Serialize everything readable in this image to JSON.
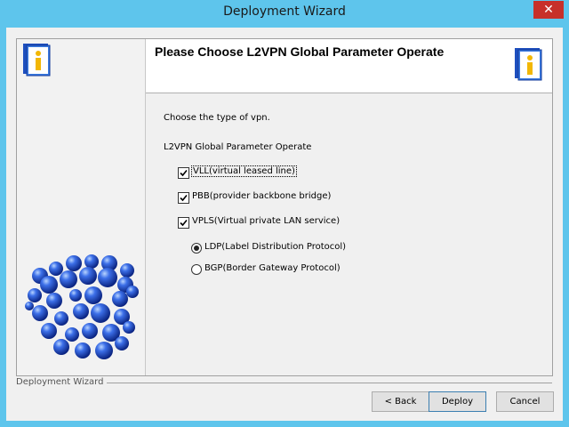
{
  "window": {
    "title": "Deployment Wizard",
    "close_glyph": "✕"
  },
  "header": {
    "title": "Please Choose L2VPN Global Parameter Operate",
    "icon": "info-icon"
  },
  "body": {
    "intro": "Choose the type of vpn.",
    "group_label": "L2VPN Global Parameter Operate",
    "options": [
      {
        "label": "VLL(virtual leased line)",
        "checked": true,
        "focused": true
      },
      {
        "label": "PBB(provider backbone bridge)",
        "checked": true
      },
      {
        "label": "VPLS(Virtual private LAN service)",
        "checked": true
      }
    ],
    "radios": [
      {
        "label": "LDP(Label Distribution Protocol)",
        "selected": true
      },
      {
        "label": "BGP(Border Gateway Protocol)",
        "selected": false
      }
    ]
  },
  "footer": {
    "label": "Deployment Wizard",
    "back_label": "< Back",
    "deploy_label": "Deploy",
    "cancel_label": "Cancel"
  },
  "colors": {
    "title_bar": "#5ec5ec",
    "close_button": "#c7302a",
    "sphere_blue": "#1f4fd0"
  }
}
